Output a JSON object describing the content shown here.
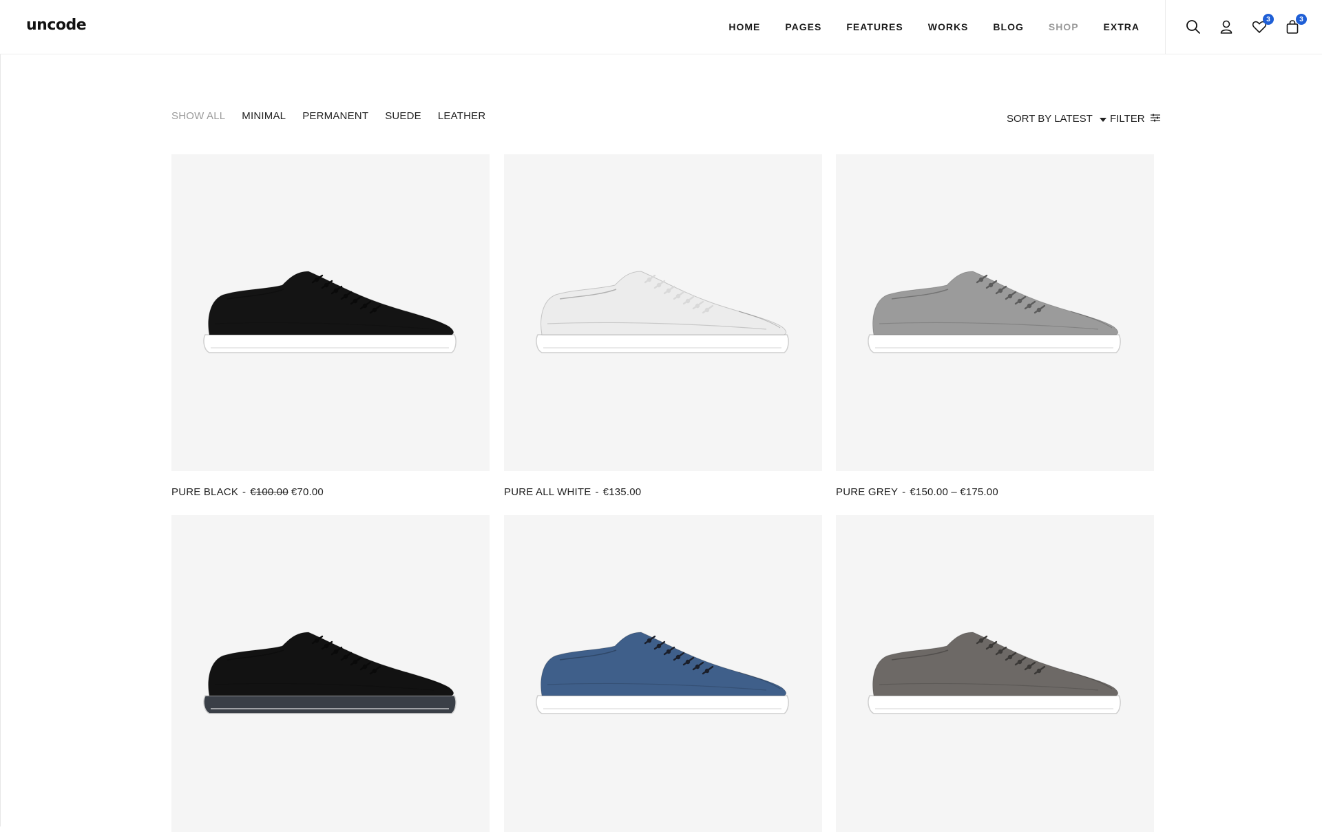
{
  "brand": {
    "logo": "uncode"
  },
  "nav": [
    {
      "label": "HOME"
    },
    {
      "label": "PAGES"
    },
    {
      "label": "FEATURES"
    },
    {
      "label": "WORKS"
    },
    {
      "label": "BLOG"
    },
    {
      "label": "SHOP",
      "active": true
    },
    {
      "label": "EXTRA"
    }
  ],
  "header_icons": {
    "search": "search-icon",
    "account": "user-icon",
    "wishlist": {
      "icon": "heart-icon",
      "count": "3"
    },
    "cart": {
      "icon": "bag-icon",
      "count": "3"
    }
  },
  "filters": {
    "categories": [
      "SHOW ALL",
      "MINIMAL",
      "PERMANENT",
      "SUEDE",
      "LEATHER"
    ],
    "active": "SHOW ALL",
    "sort_label": "SORT BY LATEST",
    "filter_label": "FILTER"
  },
  "products": [
    {
      "name": "PURE BLACK",
      "old_price": "€100.00",
      "price": "€70.00",
      "colors": {
        "upper": "#141414",
        "sole": "#ffffff",
        "lace": "#0a0a0a"
      }
    },
    {
      "name": "PURE ALL WHITE",
      "old_price": "",
      "price": "€135.00",
      "colors": {
        "upper": "#ececec",
        "sole": "#ffffff",
        "lace": "#d9d9d9"
      }
    },
    {
      "name": "PURE GREY",
      "old_price": "",
      "price": "€150.00 – €175.00",
      "colors": {
        "upper": "#9b9b9b",
        "sole": "#ffffff",
        "lace": "#5c5c5c"
      }
    },
    {
      "name": "",
      "old_price": "",
      "price": "",
      "colors": {
        "upper": "#121212",
        "sole": "#3a3f47",
        "lace": "#0a0a0a"
      }
    },
    {
      "name": "",
      "old_price": "",
      "price": "",
      "colors": {
        "upper": "#3f5f8a",
        "sole": "#ffffff",
        "lace": "#1b1f2a"
      }
    },
    {
      "name": "",
      "old_price": "",
      "price": "",
      "colors": {
        "upper": "#6d6966",
        "sole": "#ffffff",
        "lace": "#3b3937"
      }
    }
  ],
  "theme": {
    "badge": "#1f5fd6",
    "muted": "#9a9a9a",
    "card_bg": "#f5f5f5"
  }
}
